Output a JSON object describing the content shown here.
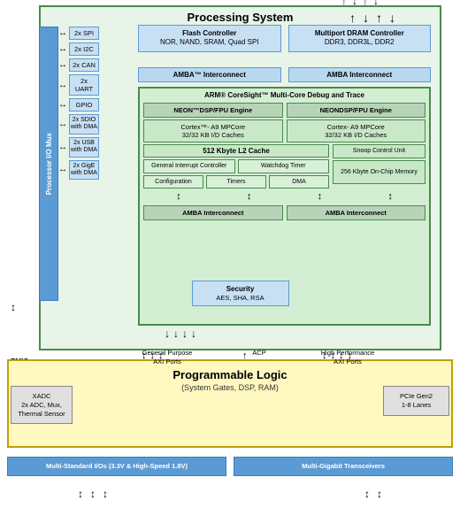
{
  "diagram": {
    "processing_system_title": "Processing System",
    "programmable_logic_title": "Programmable Logic",
    "programmable_logic_subtitle": "(System Gates, DSP, RAM)",
    "controllers": {
      "flash": {
        "title": "Flash Controller",
        "subtitle": "NOR, NAND, SRAM, Quad SPI"
      },
      "dram": {
        "title": "Multiport DRAM Controller",
        "subtitle": "DDR3, DDR3L, DDR2"
      }
    },
    "amba_top_left": "AMBA™ Interconnect",
    "amba_top_right": "AMBA Interconnect",
    "arm_title": "ARM® CoreSight™ Multi-Core Debug and Trace",
    "neon": {
      "left": "NEON™DSP/FPU Engine",
      "right": "NEONDSP/FPU Engine"
    },
    "cortex": {
      "left_line1": "Cortex™- A9 MPCore",
      "left_line2": "32/32 KB I/D Caches",
      "right_line1": "Cortex- A9 MPCore",
      "right_line2": "32/32 KB I/D Caches"
    },
    "l2_cache": "512 Kbyte L2 Cache",
    "interrupt_controller": "General Interrupt Controller",
    "watchdog_timer": "Watchdog Timer",
    "snoop_control_unit": "Snoop Control Unit",
    "onchip_memory": "256 Kbyte On-Chip Memory",
    "configuration": "Configuration",
    "timers": "Timers",
    "dma": "DMA",
    "amba_bottom_left": "AMBA Interconnect",
    "amba_bottom_right": "AMBA Interconnect",
    "security": "Security",
    "security_detail": "AES, SHA, RSA",
    "peripherals": {
      "spi": "2x SPI",
      "i2c": "2x I2C",
      "can": "2x CAN",
      "uart": "2x UART",
      "gpio": "GPIO",
      "sdio": "2x SDIO with DMA",
      "usb": "2x USB with DMA",
      "gige": "2x GigE with DMA"
    },
    "io_mux_label": "Processor I/O Mux",
    "emio": "EMIO",
    "xadc": "XADC\n2x ADC, Mux,\nThermal Sensor",
    "pcie": "PCIe Gen2\n1-8 Lanes",
    "gp_axi": "General Purpose\nAXI Ports",
    "acp": "ACP",
    "hp_axi": "High Performance\nAXI Ports",
    "bottom_io_left": "Multi-Standard I/Os (3.3V & High-Speed 1.8V)",
    "bottom_io_right": "Multi-Gigabit Transceivers"
  }
}
